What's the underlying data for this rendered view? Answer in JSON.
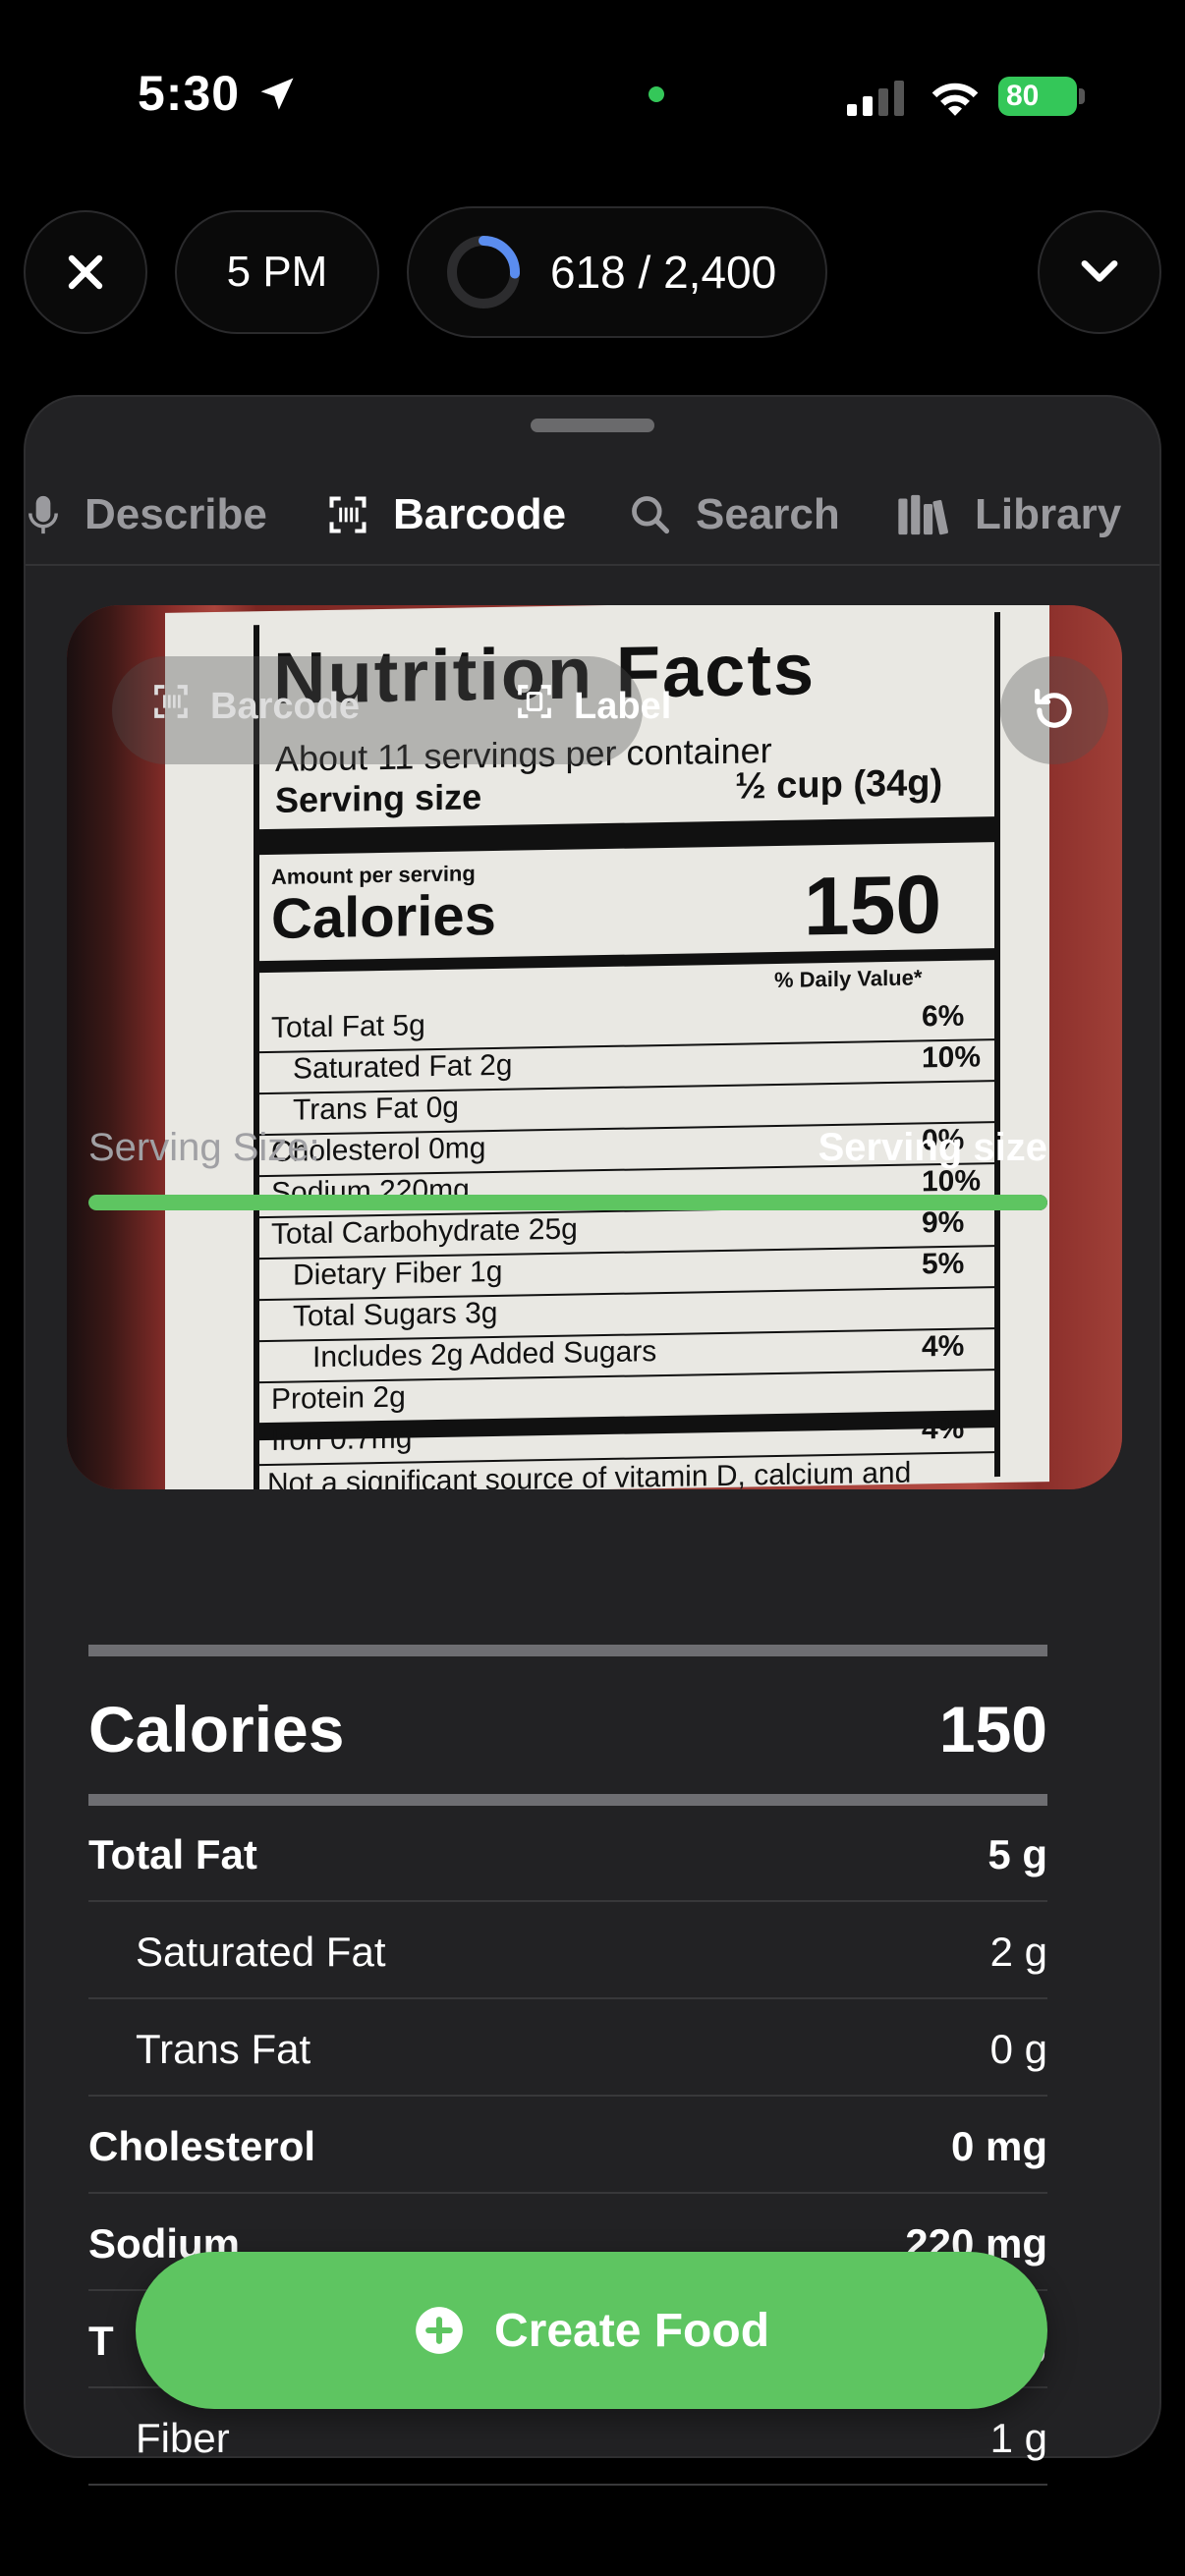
{
  "status_bar": {
    "time": "5:30",
    "battery": "80"
  },
  "top_bar": {
    "meal_time": "5 PM",
    "calories": "618 / 2,400",
    "calorie_progress": 0.2575
  },
  "tabs": [
    {
      "label": "Describe",
      "icon": "mic-icon"
    },
    {
      "label": "Barcode",
      "icon": "barcode-icon"
    },
    {
      "label": "Search",
      "icon": "search-icon"
    },
    {
      "label": "Library",
      "icon": "library-icon"
    }
  ],
  "photo": {
    "overlay_barcode": "Barcode",
    "overlay_label": "Label",
    "label_text": {
      "title": "Nutrition Facts",
      "servings": "About 11 servings per container",
      "serving_size": "Serving size",
      "serving_amount": "½ cup (34g)",
      "amount_per": "Amount per serving",
      "calories": "Calories",
      "calories_value": "150",
      "daily": "% Daily Value*",
      "rows": [
        {
          "name": "Total Fat 5g",
          "dv": "6%"
        },
        {
          "name": "Saturated Fat 2g",
          "dv": "10%"
        },
        {
          "name": "Trans Fat 0g",
          "dv": ""
        },
        {
          "name": "Cholesterol 0mg",
          "dv": "0%"
        },
        {
          "name": "Sodium 220mg",
          "dv": "10%"
        },
        {
          "name": "Total Carbohydrate 25g",
          "dv": "9%"
        },
        {
          "name": "Dietary Fiber 1g",
          "dv": "5%"
        },
        {
          "name": "Total Sugars 3g",
          "dv": ""
        },
        {
          "name": "Includes 2g Added Sugars",
          "dv": "4%"
        },
        {
          "name": "Protein 2g",
          "dv": ""
        },
        {
          "name": "Iron 0.7mg",
          "dv": "4%"
        }
      ],
      "footer": "Not a significant source of vitamin D, calcium and"
    }
  },
  "serving": {
    "label": "Serving Size:",
    "value": "Serving size",
    "progress": 1.0
  },
  "calories": {
    "label": "Calories",
    "value": "150"
  },
  "nutrients": [
    {
      "label": "Total Fat",
      "value": "5 g",
      "bold": true
    },
    {
      "label": "Saturated Fat",
      "value": "2 g",
      "bold": false
    },
    {
      "label": "Trans Fat",
      "value": "0 g",
      "bold": false
    },
    {
      "label": "Cholesterol",
      "value": "0 mg",
      "bold": true
    },
    {
      "label": "Sodium",
      "value": "220 mg",
      "bold": true
    },
    {
      "label": "T",
      "value": "g",
      "bold": true
    },
    {
      "label": "Fiber",
      "value": "1 g",
      "bold": false
    }
  ],
  "create_button": {
    "label": "Create Food"
  },
  "colors": {
    "accent": "#5ec561",
    "ring": "#5b8def",
    "sheet": "#222224"
  }
}
